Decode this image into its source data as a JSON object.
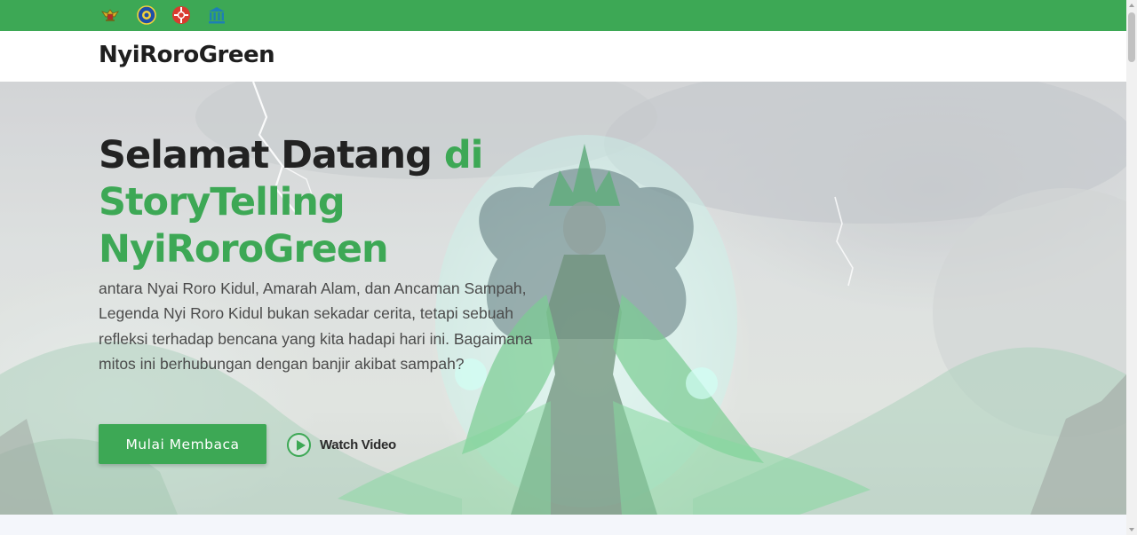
{
  "topbar": {
    "logos": [
      "garuda-emblem-icon",
      "university-seal-icon",
      "red-badge-icon",
      "unesco-icon"
    ]
  },
  "header": {
    "brand": "NyiRoroGreen"
  },
  "hero": {
    "title_part1": "Selamat Datang ",
    "title_part2": "di StoryTelling NyiRoroGreen",
    "description": "antara Nyai Roro Kidul, Amarah Alam, dan Ancaman Sampah, Legenda Nyi Roro Kidul bukan sekadar cerita, tetapi sebuah refleksi terhadap bencana yang kita hadapi hari ini. Bagaimana mitos ini berhubungan dengan banjir akibat sampah?",
    "primary_button": "Mulai Membaca",
    "video_button": "Watch Video"
  },
  "colors": {
    "brand_green": "#3da855",
    "heading_dark": "#222222",
    "body_text": "#4b4b4b"
  }
}
